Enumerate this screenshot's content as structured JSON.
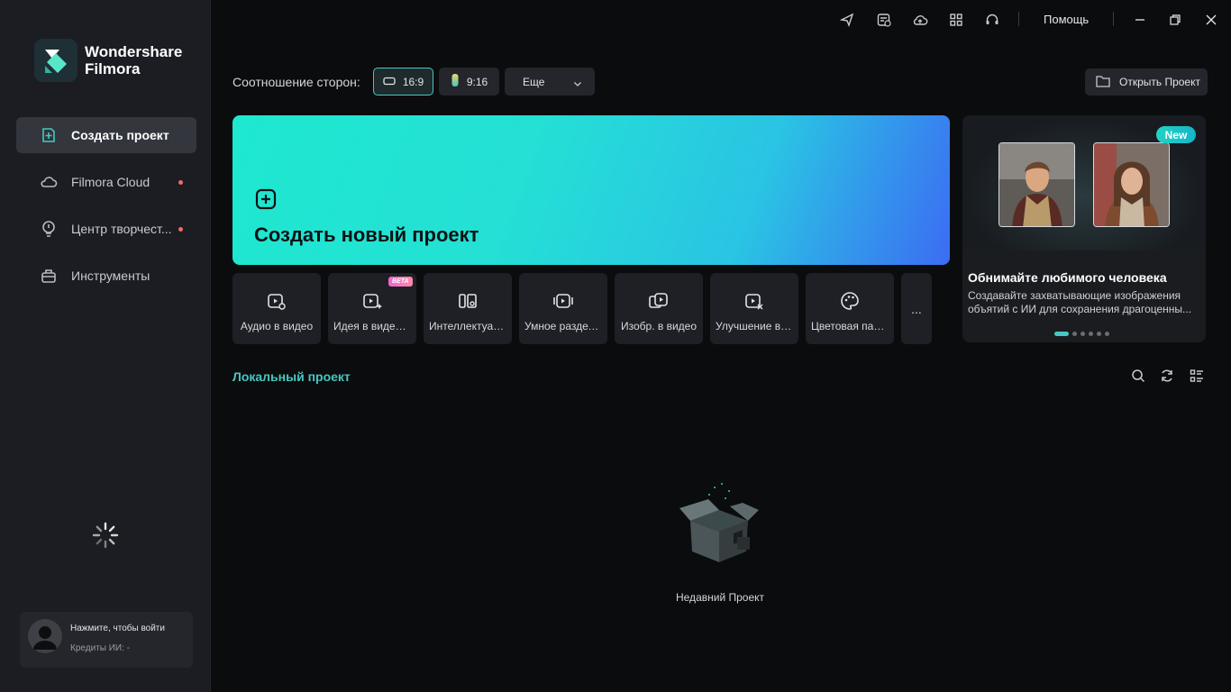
{
  "brand": {
    "name_line1": "Wondershare",
    "name_line2": "Filmora"
  },
  "sidebar": {
    "items": [
      {
        "label": "Создать проект",
        "icon": "plus-square-icon",
        "active": true,
        "dot": false
      },
      {
        "label": "Filmora Cloud",
        "icon": "cloud-icon",
        "active": false,
        "dot": true
      },
      {
        "label": "Центр творчест...",
        "icon": "lightbulb-icon",
        "active": false,
        "dot": true
      },
      {
        "label": "Инструменты",
        "icon": "toolbox-icon",
        "active": false,
        "dot": false
      }
    ],
    "account": {
      "login_text": "Нажмите, чтобы войти",
      "credits_text": "Кредиты ИИ: -"
    }
  },
  "topbar": {
    "icons": [
      "send-icon",
      "calendar-clock-icon",
      "cloud-upload-icon",
      "grid-icon",
      "headset-icon"
    ],
    "help_label": "Помощь",
    "window_controls": [
      "minimize-icon",
      "restore-icon",
      "close-icon"
    ]
  },
  "aspect": {
    "label": "Соотношение сторон:",
    "options": [
      {
        "label": "16:9",
        "selected": true
      },
      {
        "label": "9:16",
        "selected": false
      }
    ],
    "more_label": "Еще"
  },
  "open_project_label": "Открыть Проект",
  "create": {
    "title": "Создать новый проект"
  },
  "tools": [
    {
      "label": "Аудио в видео",
      "icon": "audio-video-icon",
      "badge": ""
    },
    {
      "label": "Идея в видео с...",
      "icon": "idea-video-icon",
      "badge": "BETA"
    },
    {
      "label": "Интеллектуаль...",
      "icon": "smart-crop-icon",
      "badge": ""
    },
    {
      "label": "Умное разделе...",
      "icon": "smart-split-icon",
      "badge": ""
    },
    {
      "label": "Изобр. в видео",
      "icon": "image-to-video-icon",
      "badge": ""
    },
    {
      "label": "Улучшение ви...",
      "icon": "video-enhance-icon",
      "badge": ""
    },
    {
      "label": "Цветовая пали...",
      "icon": "color-palette-icon",
      "badge": ""
    }
  ],
  "tools_more": "...",
  "promo": {
    "badge": "New",
    "title": "Обнимайте любимого человека",
    "description": "Создавайте захватывающие изображения объятий с ИИ для сохранения драгоценны...",
    "slides": 6,
    "active_slide": 0
  },
  "local": {
    "title": "Локальный проект",
    "empty_label": "Недавний Проект"
  },
  "colors": {
    "accent": "#46c7c0",
    "sidebar_bg": "#1b1d22",
    "main_bg": "#0b0c0e"
  }
}
